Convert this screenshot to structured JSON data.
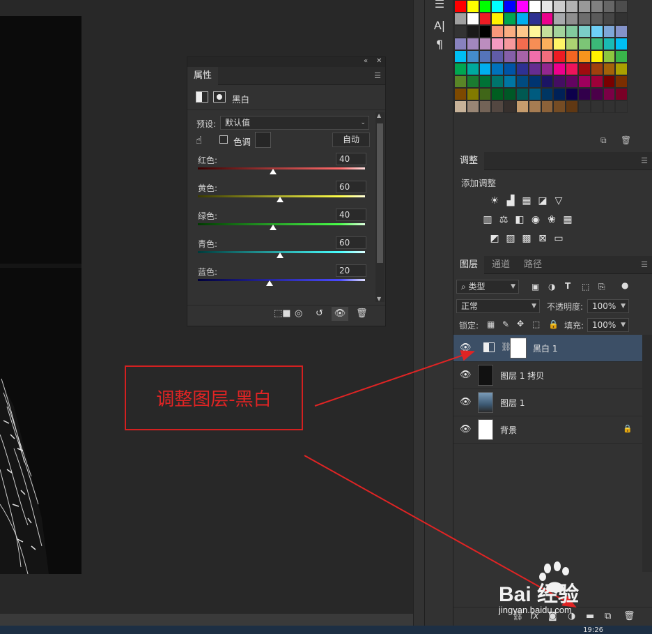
{
  "properties_panel": {
    "tab": "属性",
    "header_title": "黑白",
    "preset_label": "预设:",
    "preset_value": "默认值",
    "tint_label": "色调",
    "auto_button": "自动",
    "sliders": [
      {
        "label": "红色:",
        "value": "40",
        "fraction": 0.45
      },
      {
        "label": "黄色:",
        "value": "60",
        "fraction": 0.49
      },
      {
        "label": "绿色:",
        "value": "40",
        "fraction": 0.45
      },
      {
        "label": "青色:",
        "value": "60",
        "fraction": 0.49
      },
      {
        "label": "蓝色:",
        "value": "20",
        "fraction": 0.43
      }
    ]
  },
  "adjustments_panel": {
    "tab": "调整",
    "title": "添加调整"
  },
  "layers_panel": {
    "tabs": [
      "图层",
      "通道",
      "路径"
    ],
    "filter_value": "类型",
    "blend_mode": "正常",
    "opacity_label": "不透明度:",
    "opacity_value": "100%",
    "lock_label": "锁定:",
    "fill_label": "填充:",
    "fill_value": "100%",
    "layers": [
      {
        "name": "黑白 1",
        "selected": true
      },
      {
        "name": "图层 1 拷贝",
        "selected": false
      },
      {
        "name": "图层 1",
        "selected": false
      },
      {
        "name": "背景",
        "selected": false,
        "locked": true
      }
    ]
  },
  "annotation": {
    "text": "调整图层-黑白",
    "color": "#e02424"
  },
  "watermark": {
    "logo": "Bai  经验",
    "sub": "jingyan.baidu.com"
  },
  "taskbar": {
    "clock": "19:26"
  },
  "swatch_colors": [
    "#ff0000",
    "#ffff00",
    "#00ff00",
    "#00ffff",
    "#0000ff",
    "#ff00ff",
    "#ffffff",
    "#e6e6e6",
    "#cccccc",
    "#b3b3b3",
    "#999999",
    "#808080",
    "#666666",
    "#4d4d4d",
    "#a0a0a0",
    "#ffffff",
    "#ed1c24",
    "#fff200",
    "#00a651",
    "#00aeef",
    "#2e3192",
    "#ec008c",
    "#a7a9ac",
    "#8f8f8f",
    "#6d6d6d",
    "#5a5a5a",
    "#464646",
    "#333333",
    "#333333",
    "#1a1a1a",
    "#000000",
    "#f7977a",
    "#f9ad81",
    "#fdc68a",
    "#fff79a",
    "#c4df9b",
    "#a3d39c",
    "#82ca9d",
    "#7bcdc8",
    "#6ecff6",
    "#7ea7d8",
    "#8493ca",
    "#8882be",
    "#a187be",
    "#bc8dbf",
    "#f49ac2",
    "#f6989d",
    "#f26c4f",
    "#f68e55",
    "#fbaf5c",
    "#fff467",
    "#acd372",
    "#7cc576",
    "#3bb878",
    "#1abbb4",
    "#00bff3",
    "#00bff3",
    "#448ccb",
    "#5574b9",
    "#605ca8",
    "#855fa8",
    "#a763a8",
    "#f06eaa",
    "#f26d7d",
    "#ed1c24",
    "#f26522",
    "#f7941d",
    "#fff200",
    "#8dc73f",
    "#39b54a",
    "#00a651",
    "#00a99d",
    "#00aeef",
    "#0072bc",
    "#0054a6",
    "#2e3192",
    "#662d91",
    "#92278f",
    "#ec008c",
    "#ed145b",
    "#9e0b0f",
    "#a0410d",
    "#a36209",
    "#aba000",
    "#598527",
    "#1a7b30",
    "#007236",
    "#00746b",
    "#0076a3",
    "#004b80",
    "#003471",
    "#1b1464",
    "#440e62",
    "#630460",
    "#9e005d",
    "#9e0039",
    "#790000",
    "#7b2e00",
    "#7d4900",
    "#827b00",
    "#406618",
    "#005e20",
    "#005826",
    "#005952",
    "#005b7f",
    "#003663",
    "#002157",
    "#0d004c",
    "#32004b",
    "#4b0049",
    "#7b0046",
    "#7a0026",
    "#c7b299",
    "#998675",
    "#736357",
    "#534741",
    "#37302d",
    "#c69c6d",
    "#a67c52",
    "#8c6239",
    "#754c24",
    "#603813",
    "#323232",
    "#323232",
    "#323232",
    "#323232"
  ]
}
